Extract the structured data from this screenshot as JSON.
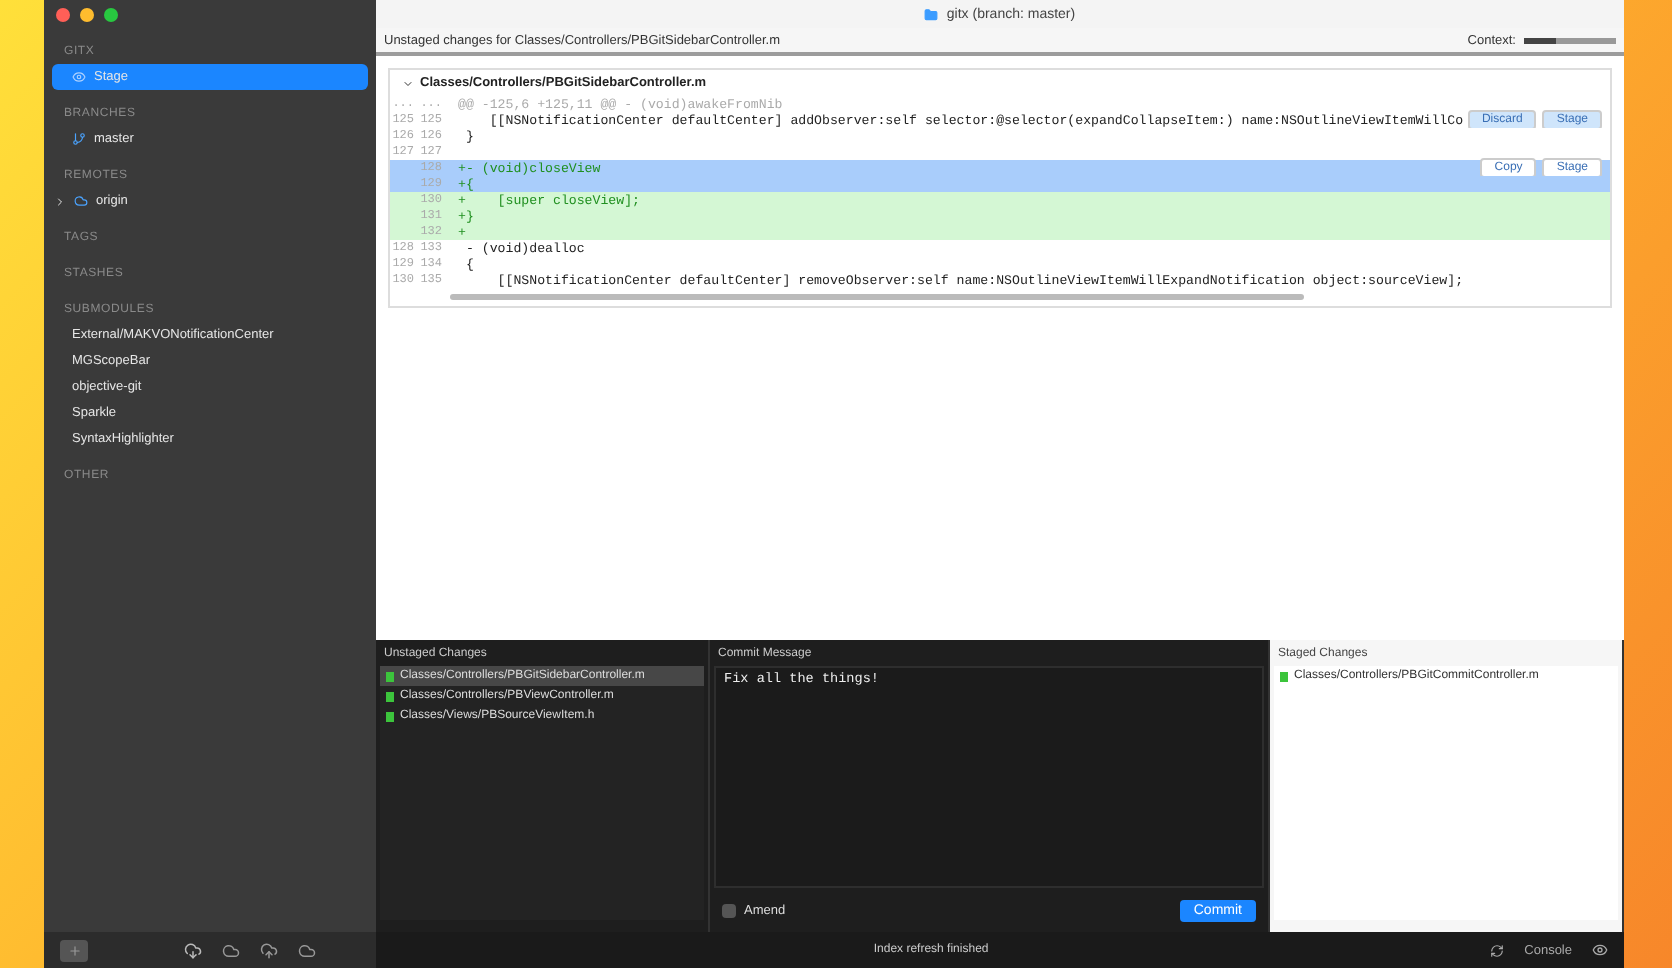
{
  "window": {
    "title": "gitx (branch: master)"
  },
  "sidebar": {
    "sections": [
      {
        "heading": "GITX",
        "items": [
          {
            "kind": "stage",
            "label": "Stage",
            "selected": true
          }
        ]
      },
      {
        "heading": "BRANCHES",
        "items": [
          {
            "kind": "branch",
            "label": "master",
            "selected": false
          }
        ]
      },
      {
        "heading": "REMOTES",
        "items": [
          {
            "kind": "remote",
            "label": "origin",
            "selected": false,
            "expanded": false
          }
        ]
      },
      {
        "heading": "TAGS"
      },
      {
        "heading": "STASHES"
      },
      {
        "heading": "SUBMODULES",
        "items": [
          {
            "kind": "submodule",
            "label": "External/MAKVONotificationCenter",
            "selected": false
          },
          {
            "kind": "submodule",
            "label": "MGScopeBar",
            "selected": false
          },
          {
            "kind": "submodule",
            "label": "objective-git",
            "selected": false
          },
          {
            "kind": "submodule",
            "label": "Sparkle",
            "selected": false
          },
          {
            "kind": "submodule",
            "label": "SyntaxHighlighter",
            "selected": false
          }
        ]
      },
      {
        "heading": "OTHER"
      }
    ]
  },
  "header": {
    "title": "Unstaged changes for Classes/Controllers/PBGitSidebarController.m",
    "context_label": "Context:",
    "context_slider": {
      "level": 0.35
    }
  },
  "diff": {
    "file": "Classes/Controllers/PBGitSidebarController.m",
    "expanded": true,
    "lines": [
      {
        "kind": "hunk",
        "old": "...",
        "new": "...",
        "text": "@@ -125,6 +125,11 @@ - (void)awakeFromNib",
        "selected": false
      },
      {
        "kind": "context",
        "old": "125",
        "new": "125",
        "text": "    [[NSNotificationCenter defaultCenter] addObserver:self selector:@selector(expandCollapseItem:) name:NSOutlineViewItemWillCo",
        "selected": false,
        "buttons": [
          "Discard",
          "Stage"
        ]
      },
      {
        "kind": "context",
        "old": "126",
        "new": "126",
        "text": " }",
        "selected": false
      },
      {
        "kind": "context",
        "old": "127",
        "new": "127",
        "selected": false
      },
      {
        "kind": "added",
        "new": "128",
        "text": "+- (void)closeView",
        "selected": true,
        "buttons": [
          "Copy",
          "Stage"
        ]
      },
      {
        "kind": "added",
        "new": "129",
        "text": "+{",
        "selected": true
      },
      {
        "kind": "added",
        "new": "130",
        "text": "+    [super closeView];",
        "selected": false
      },
      {
        "kind": "added",
        "new": "131",
        "text": "+}",
        "selected": false
      },
      {
        "kind": "added",
        "new": "132",
        "text": "+",
        "selected": false
      },
      {
        "kind": "context",
        "old": "128",
        "new": "133",
        "text": " - (void)dealloc",
        "selected": false
      },
      {
        "kind": "context",
        "old": "129",
        "new": "134",
        "text": " {",
        "selected": false
      },
      {
        "kind": "context",
        "old": "130",
        "new": "135",
        "text": "     [[NSNotificationCenter defaultCenter] removeObserver:self name:NSOutlineViewItemWillExpandNotification object:sourceView];",
        "selected": false
      }
    ]
  },
  "unstaged": {
    "title": "Unstaged Changes",
    "files": [
      {
        "path": "Classes/Controllers/PBGitSidebarController.m",
        "selected": true,
        "color": "#3cc43c"
      },
      {
        "path": "Classes/Controllers/PBViewController.m",
        "selected": false,
        "color": "#3cc43c"
      },
      {
        "path": "Classes/Views/PBSourceViewItem.h",
        "selected": false,
        "color": "#3cc43c"
      }
    ]
  },
  "commit": {
    "title": "Commit Message",
    "message": "Fix all the things!",
    "amend_label": "Amend",
    "amend_checked": false,
    "button": "Commit"
  },
  "staged": {
    "title": "Staged Changes",
    "files": [
      {
        "path": "Classes/Controllers/PBGitCommitController.m",
        "selected": false,
        "color": "#3cc43c"
      }
    ]
  },
  "status_bar": {
    "message": "Index refresh finished",
    "console": "Console"
  }
}
